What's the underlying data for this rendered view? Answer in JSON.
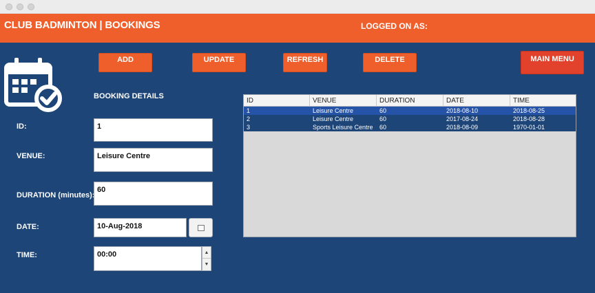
{
  "window": {
    "controls": [
      "close",
      "minimize",
      "zoom"
    ]
  },
  "header": {
    "title": "CLUB BADMINTON | BOOKINGS",
    "logged_on": "LOGGED ON AS:"
  },
  "toolbar": {
    "add": "ADD",
    "update": "UPDATE",
    "refresh": "REFRESH",
    "delete": "DELETE",
    "main_menu": "MAIN MENU"
  },
  "form": {
    "section_title": "BOOKING DETAILS",
    "id_label": "ID:",
    "id_value": "1",
    "venue_label": "VENUE:",
    "venue_value": "Leisure Centre",
    "duration_label": "DURATION (minutes):",
    "duration_value": "60",
    "date_label": "DATE:",
    "date_value": "10-Aug-2018",
    "time_label": "TIME:",
    "time_value": "00:00"
  },
  "table": {
    "columns": [
      "ID",
      "VENUE",
      "DURATION",
      "DATE",
      "TIME"
    ],
    "rows": [
      [
        "1",
        "Leisure Centre",
        "60",
        "2018-08-10",
        "2018-08-25"
      ],
      [
        "2",
        "Leisure Centre",
        "60",
        "2017-08-24",
        "2018-08-28"
      ],
      [
        "3",
        "Sports Leisure Centre",
        "60",
        "2018-08-09",
        "1970-01-01"
      ]
    ]
  },
  "colors": {
    "header": "#ee5f2c",
    "background": "#1d4577",
    "selection": "#2553a8",
    "main_menu": "#e2412c"
  },
  "icons": {
    "app": "calendar-check-icon",
    "date_picker": "calendar-icon",
    "spinner": "spinner-arrows-icon"
  }
}
